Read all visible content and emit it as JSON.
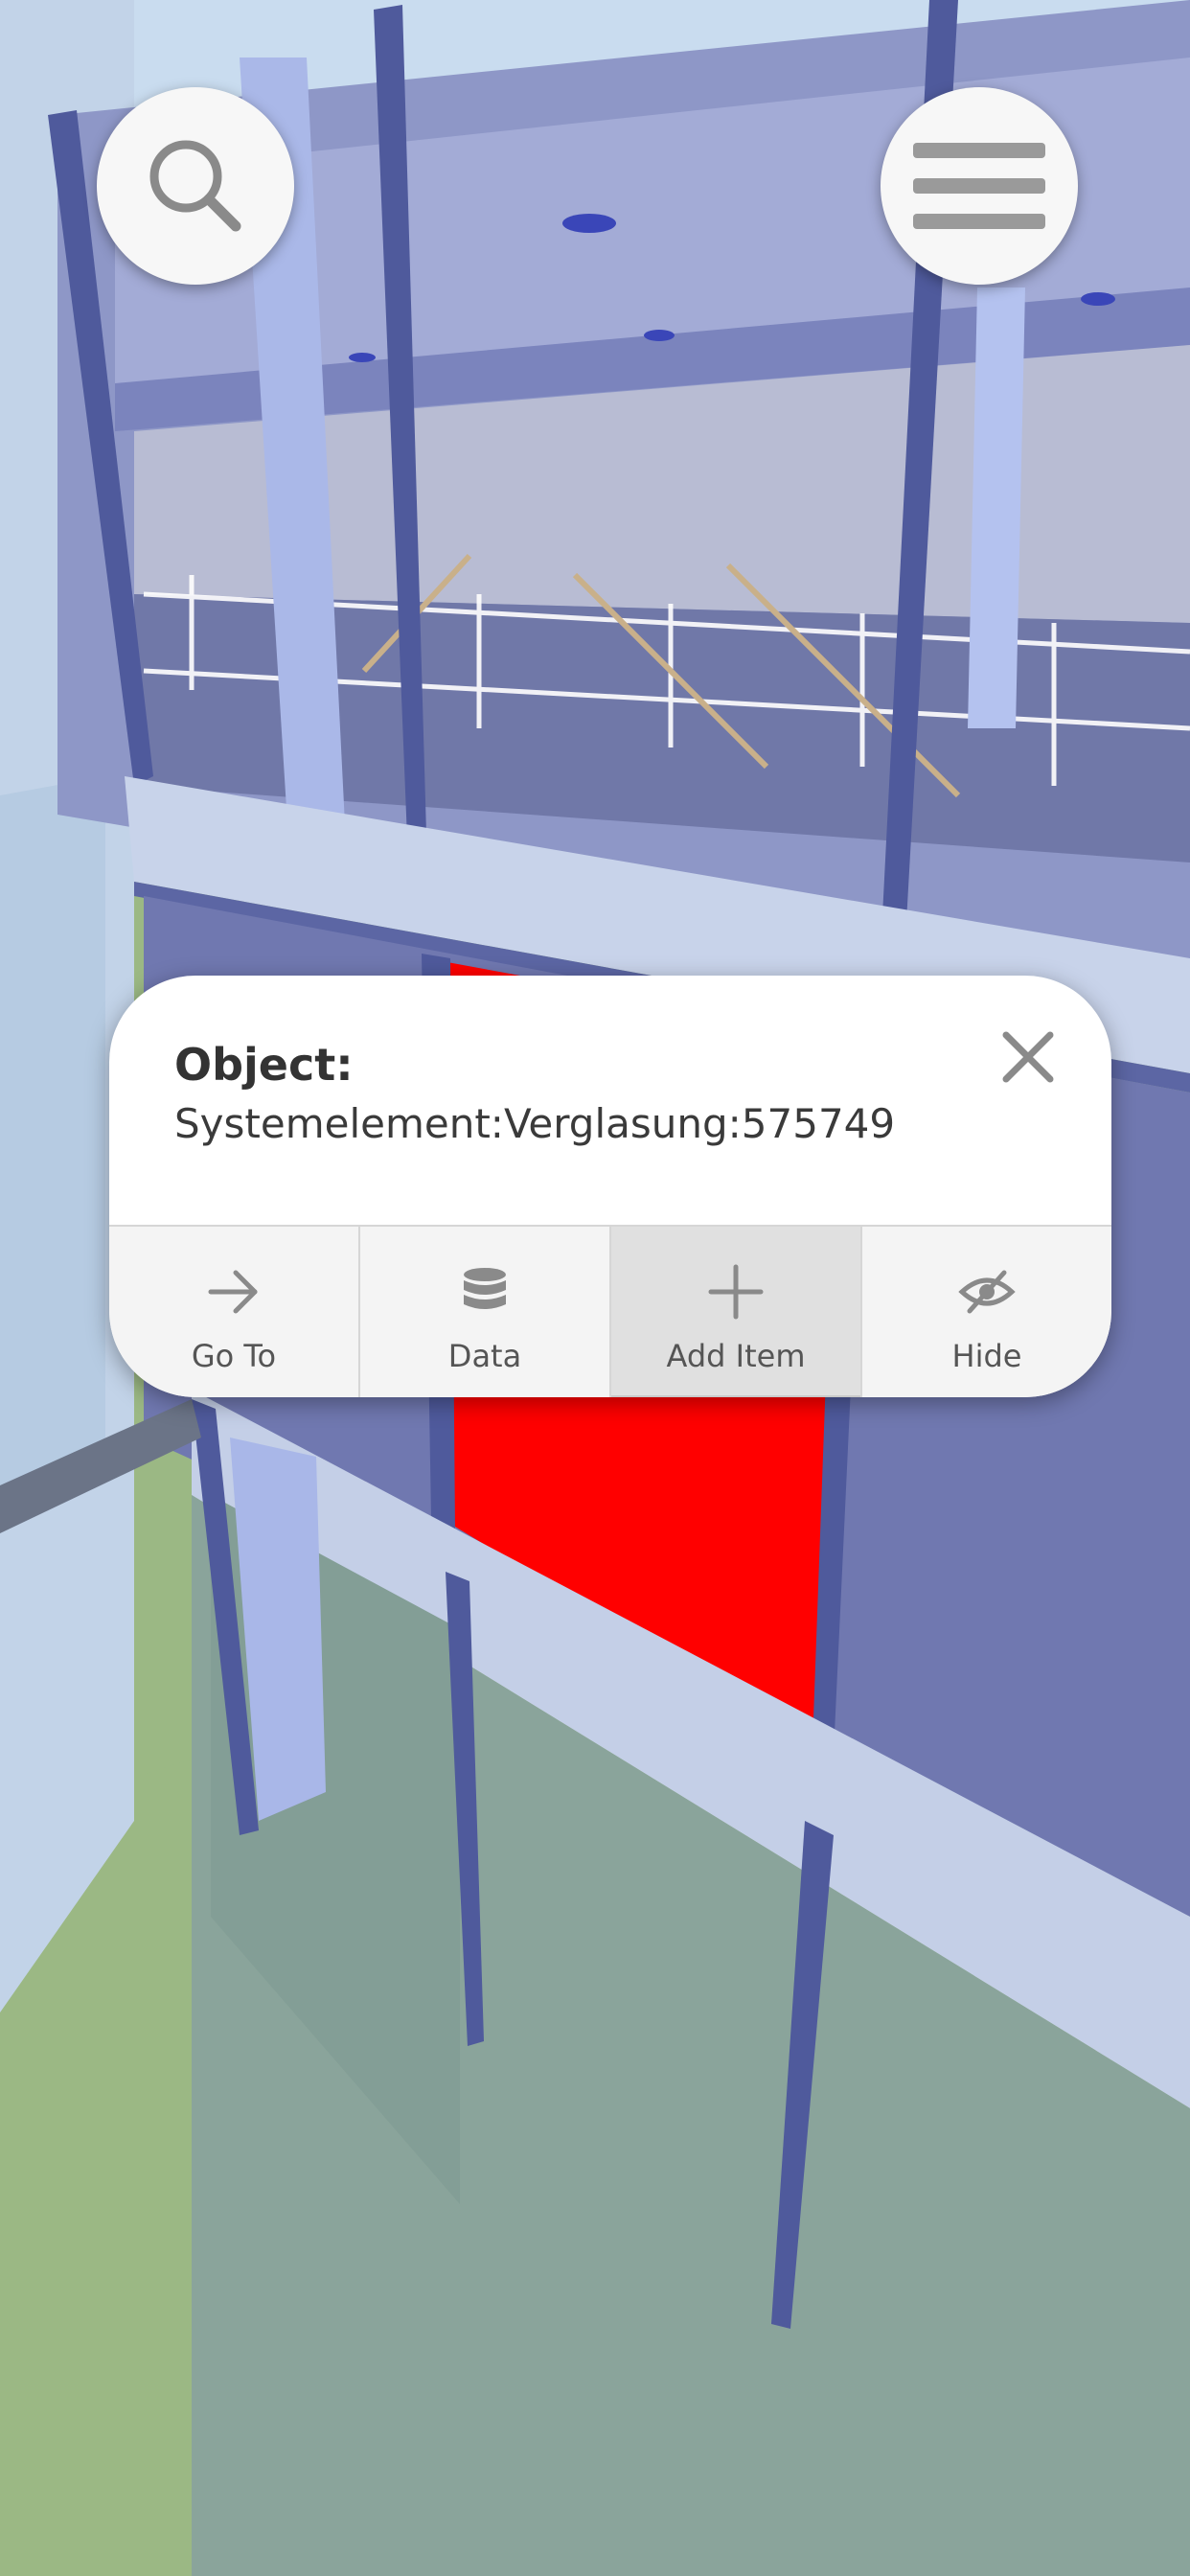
{
  "toolbar": {
    "search_icon": "search-icon",
    "menu_icon": "hamburger-menu-icon"
  },
  "popup": {
    "title": "Object:",
    "value": "Systemelement:Verglasung:575749",
    "close_icon": "close-icon",
    "actions": [
      {
        "label": "Go To",
        "icon": "arrow-right-icon",
        "active": false
      },
      {
        "label": "Data",
        "icon": "database-icon",
        "active": false
      },
      {
        "label": "Add Item",
        "icon": "plus-icon",
        "active": true
      },
      {
        "label": "Hide",
        "icon": "eye-slash-icon",
        "active": false
      }
    ]
  },
  "colors": {
    "selection": "#ff0000",
    "glass": "#7680b8",
    "frame": "#4f5a9c",
    "ground": "#9bb884"
  }
}
